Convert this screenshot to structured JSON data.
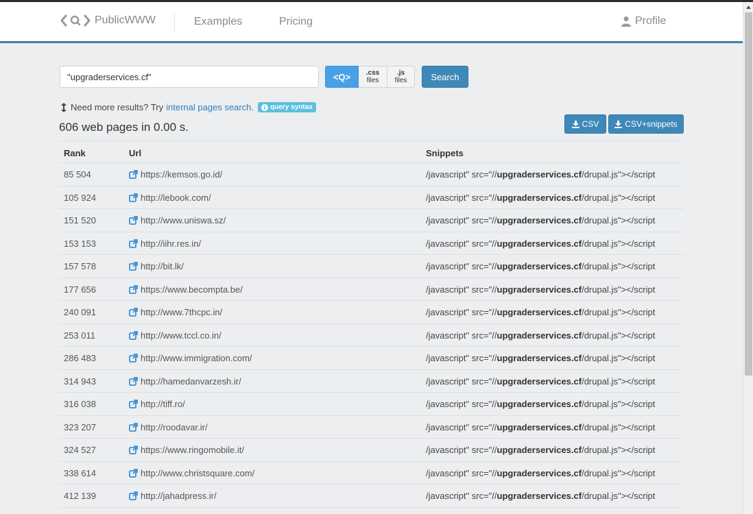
{
  "nav": {
    "brand": "PublicWWW",
    "examples": "Examples",
    "pricing": "Pricing",
    "profile": "Profile"
  },
  "search": {
    "query": "\"upgraderservices.cf\"",
    "mode_html": "<Q>",
    "mode_css_ext": ".css",
    "mode_css_files": "files",
    "mode_js_ext": ".js",
    "mode_js_files": "files",
    "button": "Search"
  },
  "hint": {
    "text": "Need more results? Try",
    "link": "internal pages search.",
    "badge": "query syntax"
  },
  "results": {
    "count_text": "606 web pages in 0.00 s.",
    "csv": "CSV",
    "csv_snippets": "CSV+snippets"
  },
  "table": {
    "headers": {
      "rank": "Rank",
      "url": "Url",
      "snippets": "Snippets"
    },
    "rows": [
      {
        "rank": "85 504",
        "url": "https://kemsos.go.id/",
        "snip_pre": "/javascript\" src=\"//",
        "snip_bold": "upgraderservices.cf",
        "snip_post": "/drupal.js\"></script"
      },
      {
        "rank": "105 924",
        "url": "http://lebook.com/",
        "snip_pre": "/javascript\" src=\"//",
        "snip_bold": "upgraderservices.cf",
        "snip_post": "/drupal.js\"></script"
      },
      {
        "rank": "151 520",
        "url": "http://www.uniswa.sz/",
        "snip_pre": "/javascript\" src=\"//",
        "snip_bold": "upgraderservices.cf",
        "snip_post": "/drupal.js\"></script"
      },
      {
        "rank": "153 153",
        "url": "http://iihr.res.in/",
        "snip_pre": "/javascript\" src=\"//",
        "snip_bold": "upgraderservices.cf",
        "snip_post": "/drupal.js\"></script"
      },
      {
        "rank": "157 578",
        "url": "http://bit.lk/",
        "snip_pre": "/javascript\" src=\"//",
        "snip_bold": "upgraderservices.cf",
        "snip_post": "/drupal.js\"></script"
      },
      {
        "rank": "177 656",
        "url": "https://www.becompta.be/",
        "snip_pre": "/javascript\" src=\"//",
        "snip_bold": "upgraderservices.cf",
        "snip_post": "/drupal.js\"></script"
      },
      {
        "rank": "240 091",
        "url": "http://www.7thcpc.in/",
        "snip_pre": "/javascript\" src=\"//",
        "snip_bold": "upgraderservices.cf",
        "snip_post": "/drupal.js\"></script"
      },
      {
        "rank": "253 011",
        "url": "http://www.tccl.co.in/",
        "snip_pre": "/javascript\" src=\"//",
        "snip_bold": "upgraderservices.cf",
        "snip_post": "/drupal.js\"></script"
      },
      {
        "rank": "286 483",
        "url": "http://www.immigration.com/",
        "snip_pre": "/javascript\" src=\"//",
        "snip_bold": "upgraderservices.cf",
        "snip_post": "/drupal.js\"></script"
      },
      {
        "rank": "314 943",
        "url": "http://hamedanvarzesh.ir/",
        "snip_pre": "/javascript\" src=\"//",
        "snip_bold": "upgraderservices.cf",
        "snip_post": "/drupal.js\"></script"
      },
      {
        "rank": "316 038",
        "url": "http://tiff.ro/",
        "snip_pre": "/javascript\" src=\"//",
        "snip_bold": "upgraderservices.cf",
        "snip_post": "/drupal.js\"></script"
      },
      {
        "rank": "323 207",
        "url": "http://roodavar.ir/",
        "snip_pre": "/javascript\" src=\"//",
        "snip_bold": "upgraderservices.cf",
        "snip_post": "/drupal.js\"></script"
      },
      {
        "rank": "324 527",
        "url": "https://www.ringomobile.it/",
        "snip_pre": "/javascript\" src=\"//",
        "snip_bold": "upgraderservices.cf",
        "snip_post": "/drupal.js\"></script"
      },
      {
        "rank": "338 614",
        "url": "http://www.christsquare.com/",
        "snip_pre": "/javascript\" src=\"//",
        "snip_bold": "upgraderservices.cf",
        "snip_post": "/drupal.js\"></script"
      },
      {
        "rank": "412 139",
        "url": "http://jahadpress.ir/",
        "snip_pre": "/javascript\" src=\"//",
        "snip_bold": "upgraderservices.cf",
        "snip_post": "/drupal.js\"></script"
      }
    ]
  },
  "colors": {
    "accent": "#3f89b8",
    "active_mode": "#4aa0e6",
    "link": "#2f7fb6",
    "badge": "#5bc0de"
  }
}
